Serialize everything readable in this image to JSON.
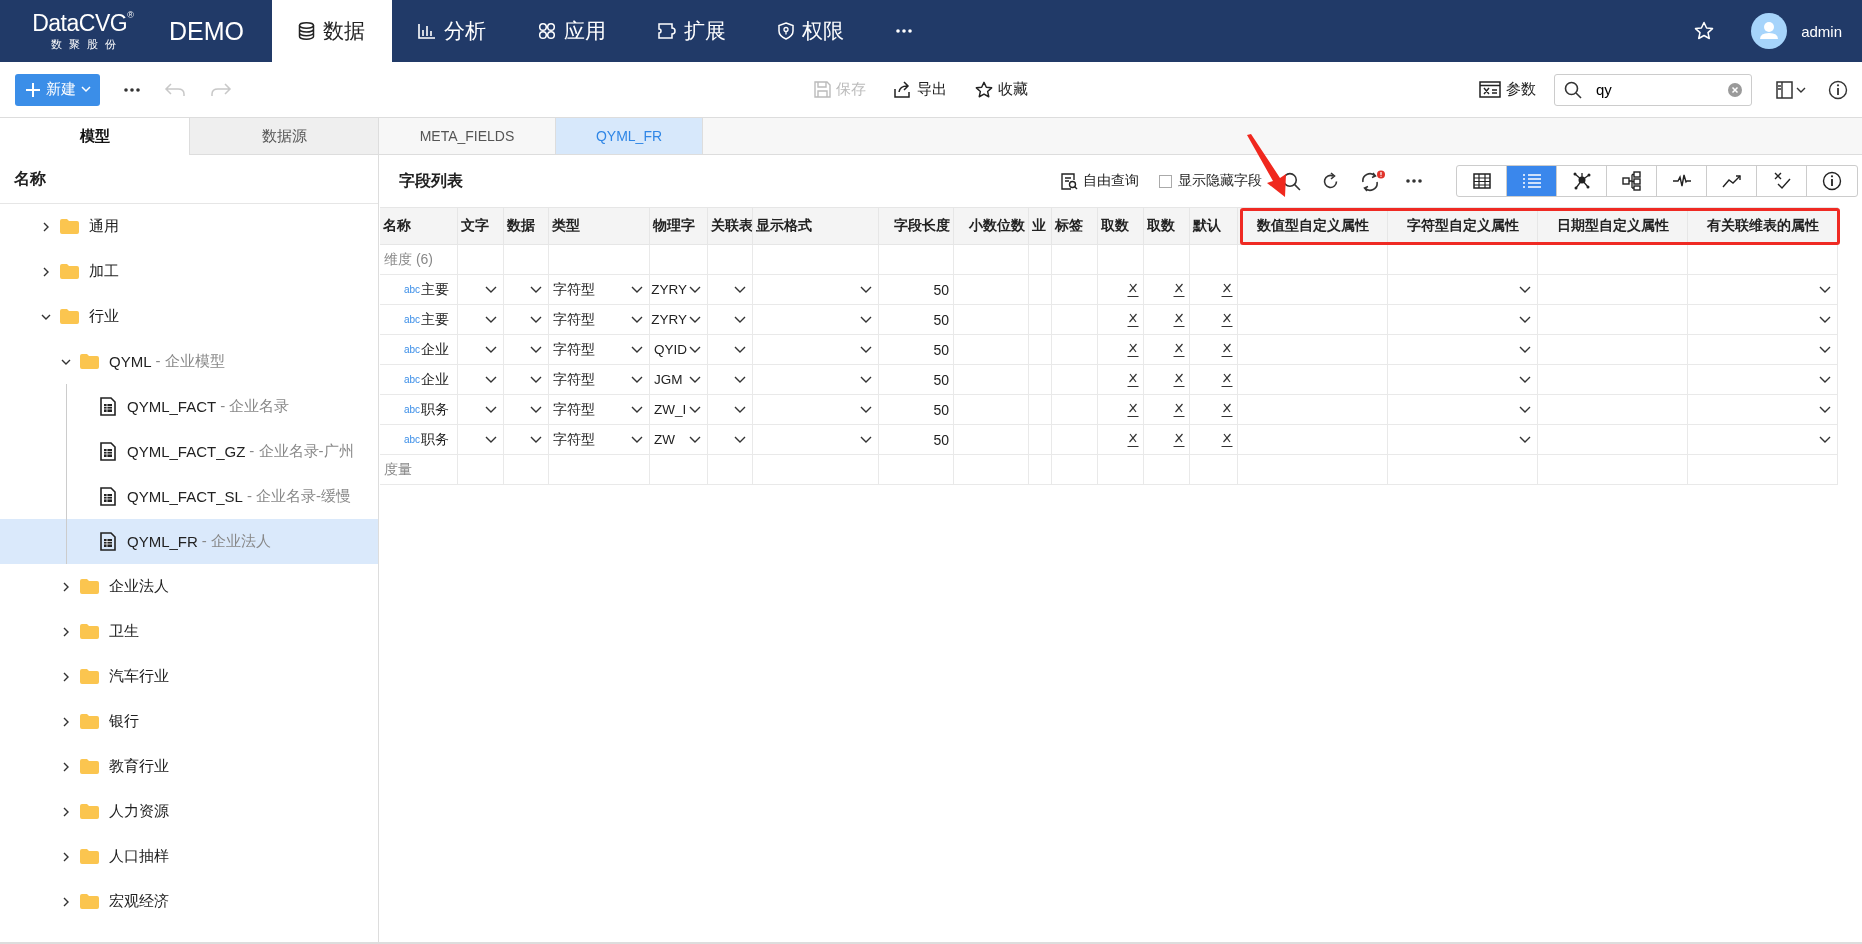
{
  "nav": {
    "logo": {
      "name": "DataCVG",
      "mark": "®",
      "tagline": "数聚股份"
    },
    "product": "DEMO",
    "tabs": [
      {
        "label": "数据",
        "kind": "database",
        "selected": true
      },
      {
        "label": "分析",
        "kind": "chart",
        "selected": false
      },
      {
        "label": "应用",
        "kind": "apps",
        "selected": false
      },
      {
        "label": "扩展",
        "kind": "plugin",
        "selected": false
      },
      {
        "label": "权限",
        "kind": "shield",
        "selected": false
      },
      {
        "kind": "more",
        "selected": false
      }
    ],
    "user": "admin"
  },
  "toolbar": {
    "new_button": "新建",
    "undo_disabled": true,
    "redo_disabled": true,
    "actions": [
      {
        "label": "保存",
        "kind": "save",
        "disabled": true
      },
      {
        "label": "导出",
        "kind": "export",
        "disabled": false
      },
      {
        "label": "收藏",
        "kind": "star",
        "disabled": false
      }
    ],
    "params": "参数",
    "search": {
      "value": "qy"
    }
  },
  "left_tabs": [
    {
      "label": "模型",
      "selected": true
    },
    {
      "label": "数据源",
      "selected": false
    }
  ],
  "doc_tabs": [
    {
      "label": "META_FIELDS",
      "selected": false
    },
    {
      "label": "QYML_FR",
      "selected": true
    }
  ],
  "sidebar": {
    "header": "名称",
    "items": [
      {
        "label": "通用",
        "kind": "folder",
        "expanded": false,
        "selected": false
      },
      {
        "label": "加工",
        "kind": "folder",
        "expanded": false,
        "selected": false
      },
      {
        "label": "行业",
        "kind": "folder",
        "expanded": true,
        "selected": false,
        "children": [
          {
            "label": "QYML",
            "note": "- 企业模型",
            "kind": "folder",
            "expanded": true,
            "selected": false,
            "children": [
              {
                "label": "QYML_FACT",
                "note": "- 企业名录",
                "kind": "table",
                "selected": false
              },
              {
                "label": "QYML_FACT_GZ",
                "note": "- 企业名录-广州",
                "kind": "table",
                "selected": false
              },
              {
                "label": "QYML_FACT_SL",
                "note": "- 企业名录-缓慢",
                "kind": "table",
                "selected": false
              },
              {
                "label": "QYML_FR",
                "note": "- 企业法人",
                "kind": "table",
                "selected": true
              }
            ]
          },
          {
            "label": "企业法人",
            "kind": "folder",
            "expanded": false,
            "selected": false
          },
          {
            "label": "卫生",
            "kind": "folder",
            "expanded": false,
            "selected": false
          },
          {
            "label": "汽车行业",
            "kind": "folder",
            "expanded": false,
            "selected": false
          },
          {
            "label": "银行",
            "kind": "folder",
            "expanded": false,
            "selected": false
          },
          {
            "label": "教育行业",
            "kind": "folder",
            "expanded": false,
            "selected": false
          },
          {
            "label": "人力资源",
            "kind": "folder",
            "expanded": false,
            "selected": false
          },
          {
            "label": "人口抽样",
            "kind": "folder",
            "expanded": false,
            "selected": false
          },
          {
            "label": "宏观经济",
            "kind": "folder",
            "expanded": false,
            "selected": false
          }
        ]
      }
    ]
  },
  "fields_panel": {
    "title": "字段列表",
    "free_query": "自由查询",
    "show_hidden": {
      "label": "显示隐藏字段",
      "checked": false
    },
    "sync_alert": true,
    "views": [
      {
        "kind": "table",
        "selected": false
      },
      {
        "kind": "list",
        "selected": true
      },
      {
        "kind": "network",
        "selected": false
      },
      {
        "kind": "tree",
        "selected": false
      },
      {
        "kind": "pulse",
        "selected": false
      },
      {
        "kind": "trend",
        "selected": false
      },
      {
        "kind": "check",
        "selected": false
      },
      {
        "kind": "info",
        "selected": false
      }
    ],
    "annotation_arrow": true,
    "table": {
      "columns": [
        {
          "header": "名称",
          "highlighted": false
        },
        {
          "header": "文字",
          "highlighted": false
        },
        {
          "header": "数据",
          "highlighted": false
        },
        {
          "header": "类型",
          "highlighted": false
        },
        {
          "header": "物理字",
          "highlighted": false
        },
        {
          "header": "关联表",
          "highlighted": false
        },
        {
          "header": "显示格式",
          "highlighted": false
        },
        {
          "header": "字段长度",
          "highlighted": false
        },
        {
          "header": "小数位数",
          "highlighted": false
        },
        {
          "header": "业",
          "highlighted": false
        },
        {
          "header": "标签",
          "highlighted": false
        },
        {
          "header": "取数",
          "highlighted": false
        },
        {
          "header": "取数",
          "highlighted": false
        },
        {
          "header": "默认",
          "highlighted": false
        },
        {
          "header": "数值型自定义属性",
          "highlighted": true
        },
        {
          "header": "字符型自定义属性",
          "highlighted": true
        },
        {
          "header": "日期型自定义属性",
          "highlighted": true
        },
        {
          "header": "有关联维表的属性",
          "highlighted": true
        }
      ],
      "groups": [
        {
          "label": "维度 (6)",
          "rows": [
            {
              "type_tag": "abc",
              "name": "主要",
              "cells": [
                {
                  "kind": "select"
                },
                {
                  "kind": "select"
                },
                {
                  "kind": "select",
                  "value": "字符型"
                },
                {
                  "kind": "select",
                  "value": "ZYRY"
                },
                {
                  "kind": "select"
                },
                {
                  "kind": "select"
                },
                {
                  "kind": "number",
                  "value": "50"
                },
                {
                  "kind": "blank"
                },
                {
                  "kind": "blank"
                },
                {
                  "kind": "blank"
                },
                {
                  "kind": "formula"
                },
                {
                  "kind": "formula"
                },
                {
                  "kind": "formula"
                },
                {
                  "kind": "blank"
                },
                {
                  "kind": "select"
                },
                {
                  "kind": "blank"
                },
                {
                  "kind": "select"
                }
              ]
            },
            {
              "type_tag": "abc",
              "name": "主要",
              "cells": [
                {
                  "kind": "select"
                },
                {
                  "kind": "select"
                },
                {
                  "kind": "select",
                  "value": "字符型"
                },
                {
                  "kind": "select",
                  "value": "ZYRY"
                },
                {
                  "kind": "select"
                },
                {
                  "kind": "select"
                },
                {
                  "kind": "number",
                  "value": "50"
                },
                {
                  "kind": "blank"
                },
                {
                  "kind": "blank"
                },
                {
                  "kind": "blank"
                },
                {
                  "kind": "formula"
                },
                {
                  "kind": "formula"
                },
                {
                  "kind": "formula"
                },
                {
                  "kind": "blank"
                },
                {
                  "kind": "select"
                },
                {
                  "kind": "blank"
                },
                {
                  "kind": "select"
                }
              ]
            },
            {
              "type_tag": "abc",
              "name": "企业",
              "cells": [
                {
                  "kind": "select"
                },
                {
                  "kind": "select"
                },
                {
                  "kind": "select",
                  "value": "字符型"
                },
                {
                  "kind": "select",
                  "value": "QYID"
                },
                {
                  "kind": "select"
                },
                {
                  "kind": "select"
                },
                {
                  "kind": "number",
                  "value": "50"
                },
                {
                  "kind": "blank"
                },
                {
                  "kind": "blank"
                },
                {
                  "kind": "blank"
                },
                {
                  "kind": "formula"
                },
                {
                  "kind": "formula"
                },
                {
                  "kind": "formula"
                },
                {
                  "kind": "blank"
                },
                {
                  "kind": "select"
                },
                {
                  "kind": "blank"
                },
                {
                  "kind": "select"
                }
              ]
            },
            {
              "type_tag": "abc",
              "name": "企业",
              "cells": [
                {
                  "kind": "select"
                },
                {
                  "kind": "select"
                },
                {
                  "kind": "select",
                  "value": "字符型"
                },
                {
                  "kind": "select",
                  "value": "JGM"
                },
                {
                  "kind": "select"
                },
                {
                  "kind": "select"
                },
                {
                  "kind": "number",
                  "value": "50"
                },
                {
                  "kind": "blank"
                },
                {
                  "kind": "blank"
                },
                {
                  "kind": "blank"
                },
                {
                  "kind": "formula"
                },
                {
                  "kind": "formula"
                },
                {
                  "kind": "formula"
                },
                {
                  "kind": "blank"
                },
                {
                  "kind": "select"
                },
                {
                  "kind": "blank"
                },
                {
                  "kind": "select"
                }
              ]
            },
            {
              "type_tag": "abc",
              "name": "职务",
              "cells": [
                {
                  "kind": "select"
                },
                {
                  "kind": "select"
                },
                {
                  "kind": "select",
                  "value": "字符型"
                },
                {
                  "kind": "select",
                  "value": "ZW_I"
                },
                {
                  "kind": "select"
                },
                {
                  "kind": "select"
                },
                {
                  "kind": "number",
                  "value": "50"
                },
                {
                  "kind": "blank"
                },
                {
                  "kind": "blank"
                },
                {
                  "kind": "blank"
                },
                {
                  "kind": "formula"
                },
                {
                  "kind": "formula"
                },
                {
                  "kind": "formula"
                },
                {
                  "kind": "blank"
                },
                {
                  "kind": "select"
                },
                {
                  "kind": "blank"
                },
                {
                  "kind": "select"
                }
              ]
            },
            {
              "type_tag": "abc",
              "name": "职务",
              "cells": [
                {
                  "kind": "select"
                },
                {
                  "kind": "select"
                },
                {
                  "kind": "select",
                  "value": "字符型"
                },
                {
                  "kind": "select",
                  "value": "ZW"
                },
                {
                  "kind": "select"
                },
                {
                  "kind": "select"
                },
                {
                  "kind": "number",
                  "value": "50"
                },
                {
                  "kind": "blank"
                },
                {
                  "kind": "blank"
                },
                {
                  "kind": "blank"
                },
                {
                  "kind": "formula"
                },
                {
                  "kind": "formula"
                },
                {
                  "kind": "formula"
                },
                {
                  "kind": "blank"
                },
                {
                  "kind": "select"
                },
                {
                  "kind": "blank"
                },
                {
                  "kind": "select"
                }
              ]
            }
          ]
        },
        {
          "label": "度量"
        }
      ]
    }
  }
}
